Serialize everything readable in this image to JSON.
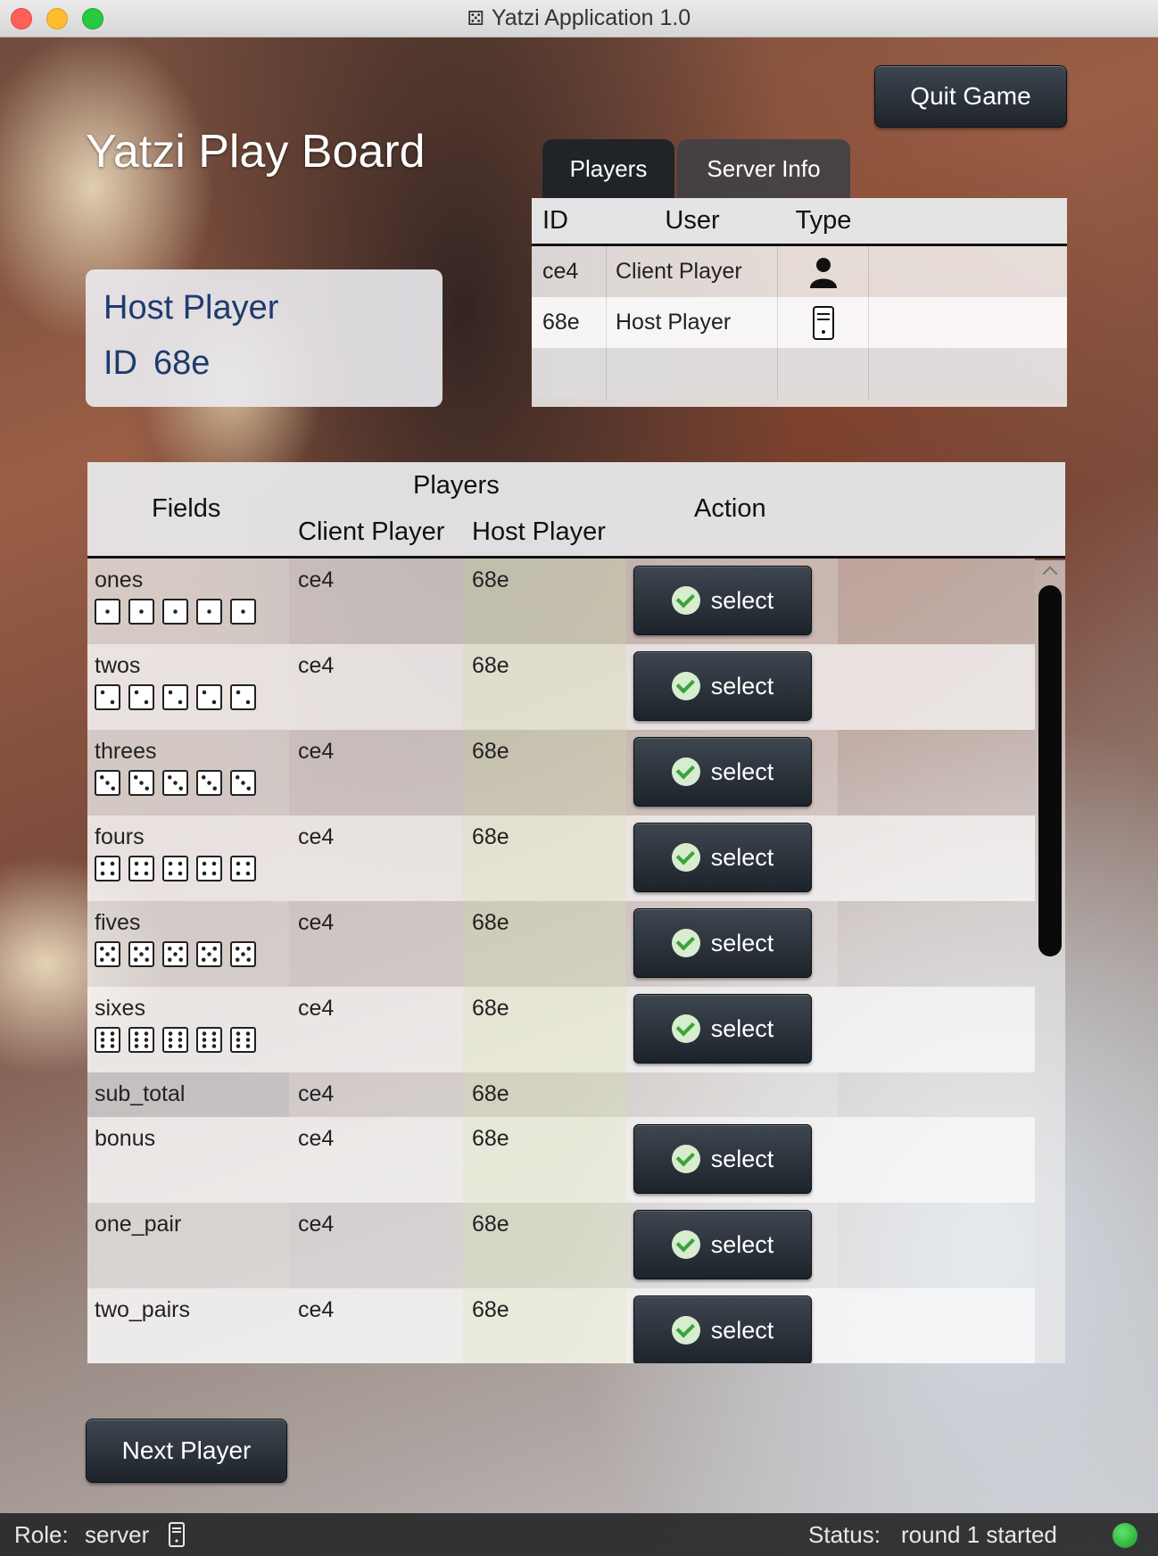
{
  "window": {
    "title": "Yatzi Application 1.0",
    "title_icon": "dice-icon"
  },
  "header": {
    "title": "Yatzi Play Board",
    "quit_label": "Quit Game"
  },
  "host_card": {
    "name": "Host Player",
    "id_label": "ID",
    "id_value": "68e"
  },
  "tabs": [
    {
      "label": "Players",
      "active": true
    },
    {
      "label": "Server Info",
      "active": false
    }
  ],
  "players_table": {
    "columns": [
      "ID",
      "User",
      "Type"
    ],
    "rows": [
      {
        "id": "ce4",
        "user": "Client Player",
        "type_icon": "person-icon"
      },
      {
        "id": "68e",
        "user": "Host Player",
        "type_icon": "server-icon"
      }
    ]
  },
  "score_table": {
    "headers": {
      "fields": "Fields",
      "players": "Players",
      "client": "Client Player",
      "host": "Host Player",
      "action": "Action"
    },
    "select_label": "select",
    "rows": [
      {
        "field": "ones",
        "client": "ce4",
        "host": "68e",
        "dice": 1,
        "selectable": true
      },
      {
        "field": "twos",
        "client": "ce4",
        "host": "68e",
        "dice": 2,
        "selectable": true
      },
      {
        "field": "threes",
        "client": "ce4",
        "host": "68e",
        "dice": 3,
        "selectable": true
      },
      {
        "field": "fours",
        "client": "ce4",
        "host": "68e",
        "dice": 4,
        "selectable": true
      },
      {
        "field": "fives",
        "client": "ce4",
        "host": "68e",
        "dice": 5,
        "selectable": true
      },
      {
        "field": "sixes",
        "client": "ce4",
        "host": "68e",
        "dice": 6,
        "selectable": true
      },
      {
        "field": "sub_total",
        "client": "ce4",
        "host": "68e",
        "dice": 0,
        "selectable": false
      },
      {
        "field": "bonus",
        "client": "ce4",
        "host": "68e",
        "dice": 0,
        "selectable": true
      },
      {
        "field": "one_pair",
        "client": "ce4",
        "host": "68e",
        "dice": 0,
        "selectable": true
      },
      {
        "field": "two_pairs",
        "client": "ce4",
        "host": "68e",
        "dice": 0,
        "selectable": true
      }
    ]
  },
  "footer": {
    "next_label": "Next Player"
  },
  "status_bar": {
    "role_label": "Role:",
    "role_value": "server",
    "status_label": "Status:",
    "status_value": "round 1 started",
    "status_color": "#2fc13a"
  }
}
